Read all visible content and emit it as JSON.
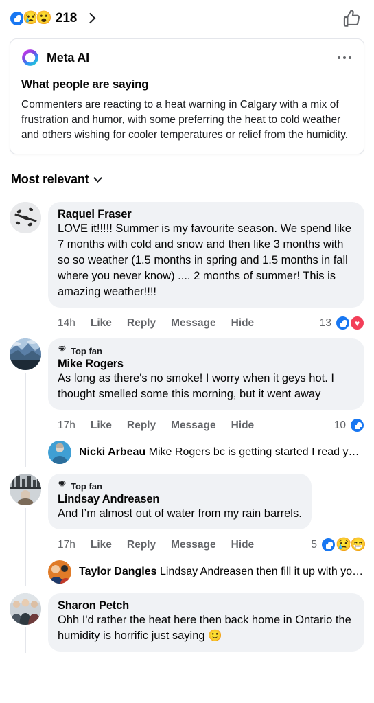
{
  "post_reactions": {
    "icons": [
      "like-icon",
      "sad-icon",
      "wow-icon"
    ],
    "count": "218",
    "chevron": "chevron-right-icon",
    "like_button_icon": "thumbs-up-outline-icon"
  },
  "meta_ai_card": {
    "brand_icon": "meta-ai-ring-icon",
    "brand_name": "Meta AI",
    "menu_icon": "more-options-icon",
    "title": "What people are saying",
    "summary": "Commenters are reacting to a heat warning in Calgary with a mix of frustration and humor, with some preferring the heat to cold weather and others wishing for cooler temperatures or relief from the humidity."
  },
  "sort": {
    "label": "Most relevant",
    "chevron": "chevron-down-icon"
  },
  "action_labels": {
    "like": "Like",
    "reply": "Reply",
    "message": "Message",
    "hide": "Hide"
  },
  "top_fan_label": "Top fan",
  "comments": [
    {
      "author": "Raquel Fraser",
      "avatar": "avatar-raquel-fraser",
      "top_fan": false,
      "text": "LOVE it!!!!! Summer is my favourite season. We spend like 7 months with cold and snow and then like 3 months with so so weather  (1.5 months in spring and 1.5 months in fall where you never know) .... 2 months of summer! This is amazing weather!!!!",
      "time": "14h",
      "reaction_count": "13",
      "reaction_icons": [
        "like-icon",
        "heart-icon"
      ],
      "replies": []
    },
    {
      "author": "Mike Rogers",
      "avatar": "avatar-mike-rogers",
      "top_fan": true,
      "text": "As long as there's no smoke! I worry when it geys hot. I thought smelled some this morning, but it went away",
      "time": "17h",
      "reaction_count": "10",
      "reaction_icons": [
        "like-icon"
      ],
      "replies": [
        {
          "author": "Nicki Arbeau",
          "avatar": "avatar-nicki-arbeau",
          "text": "Mike Rogers bc is getting started I read yest..."
        }
      ]
    },
    {
      "author": "Lindsay Andreasen",
      "avatar": "avatar-lindsay-andreasen",
      "top_fan": true,
      "text": "And I’m almost out of water from my rain barrels.",
      "time": "17h",
      "reaction_count": "5",
      "reaction_icons": [
        "like-icon",
        "sad-icon",
        "haha-icon"
      ],
      "replies": [
        {
          "author": "Taylor Dangles",
          "avatar": "avatar-taylor-dangles",
          "text": "Lindsay Andreasen then fill it up with your..."
        }
      ]
    },
    {
      "author": "Sharon Petch",
      "avatar": "avatar-sharon-petch",
      "top_fan": false,
      "text": "Ohh I'd rather the heat here then back home in Ontario the humidity is horrific just saying 🙂",
      "time": "",
      "reaction_count": "",
      "reaction_icons": [],
      "replies": []
    }
  ],
  "colors": {
    "facebook_blue": "#1877F2",
    "heart_red": "#F33E58",
    "bubble_gray": "#F0F2F5",
    "secondary_text": "#65676B"
  }
}
